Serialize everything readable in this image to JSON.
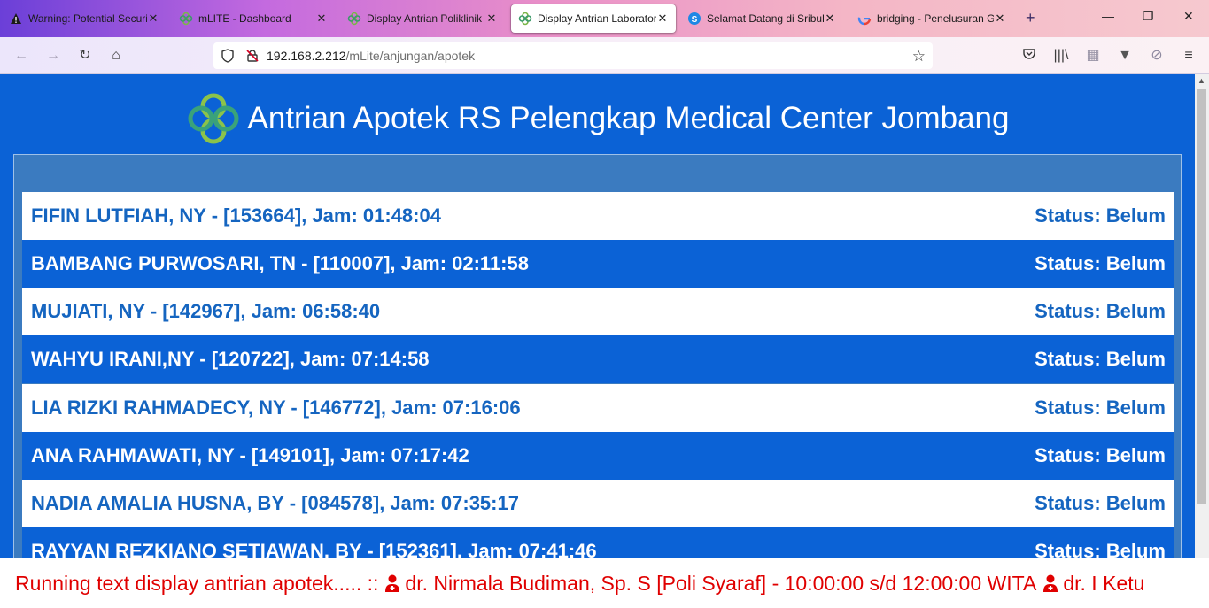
{
  "browser": {
    "tabs": [
      {
        "title": "Warning: Potential Securi",
        "icon": "warning-icon"
      },
      {
        "title": "mLITE - Dashboard",
        "icon": "mlite-logo-icon"
      },
      {
        "title": "Display Antrian Poliklinik",
        "icon": "mlite-logo-icon"
      },
      {
        "title": "Display Antrian Laborator",
        "icon": "mlite-logo-icon",
        "active": true
      },
      {
        "title": "Selamat Datang di Sribula",
        "icon": "s-logo-icon"
      },
      {
        "title": "bridging - Penelusuran Go",
        "icon": "google-icon"
      }
    ],
    "url_host": "192.168.2.212",
    "url_path": "/mLite/anjungan/apotek"
  },
  "page": {
    "title": "Antrian Apotek RS Pelengkap Medical Center Jombang",
    "queue": [
      {
        "name": "FIFIN LUTFIAH, NY - [153664], Jam: 01:48:04",
        "status": "Status: Belum"
      },
      {
        "name": "BAMBANG PURWOSARI, TN - [110007], Jam: 02:11:58",
        "status": "Status: Belum"
      },
      {
        "name": "MUJIATI, NY - [142967], Jam: 06:58:40",
        "status": "Status: Belum"
      },
      {
        "name": "WAHYU IRANI,NY - [120722], Jam: 07:14:58",
        "status": "Status: Belum"
      },
      {
        "name": "LIA RIZKI RAHMADECY, NY - [146772], Jam: 07:16:06",
        "status": "Status: Belum"
      },
      {
        "name": "ANA RAHMAWATI, NY - [149101], Jam: 07:17:42",
        "status": "Status: Belum"
      },
      {
        "name": "NADIA AMALIA HUSNA, BY - [084578], Jam: 07:35:17",
        "status": "Status: Belum"
      },
      {
        "name": "RAYYAN REZKIANO SETIAWAN, BY - [152361], Jam: 07:41:46",
        "status": "Status: Belum"
      }
    ],
    "ticker": {
      "intro": "Running text display antrian apotek..... ::",
      "doctor1": "dr. Nirmala Budiman, Sp. S [Poli Syaraf] - 10:00:00 s/d 12:00:00 WITA",
      "doctor2": "dr. I Ketu"
    }
  },
  "colors": {
    "page_bg": "#0b62d6",
    "row_light_text": "#1565c0",
    "ticker_text": "#e00000"
  }
}
